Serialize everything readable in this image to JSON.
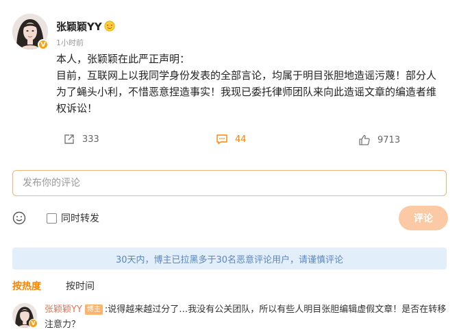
{
  "post": {
    "username": "张颖颖YY",
    "time": "1小时前",
    "verified_badge": "V",
    "content_lines": [
      "本人，张颖颖在此严正声明：",
      "目前，互联网上以我同学身份发表的全部言论，均属于明目张胆地造谣污蔑！部分人",
      "为了蝇头小利，不惜恶意捏造事实！我现已委托律师团队来向此造谣文章的编造者维",
      "权诉讼！"
    ],
    "actions": {
      "share_count": "333",
      "comment_count": "44",
      "like_count": "9713"
    }
  },
  "composer": {
    "placeholder": "发布你的评论",
    "repost_label": "同时转发",
    "submit_label": "评论"
  },
  "notice": "30天内，博主已拉黑多于30名恶意评论用户，请谨慎评论",
  "sort_tabs": [
    {
      "label": "按热度"
    },
    {
      "label": "按时间"
    }
  ],
  "comments": [
    {
      "username": "张颖颖YY",
      "badge": "博主",
      "text": ":说得越来越过分了…我没有公关团队，所以有些人明目张胆编辑虚假文章！是否在转移",
      "text_line2": "注意力？"
    }
  ],
  "colors": {
    "accent": "#ff8200",
    "verified": "#f7a11a",
    "notice_bg": "#e3eefb",
    "notice_text": "#5b86bd"
  }
}
